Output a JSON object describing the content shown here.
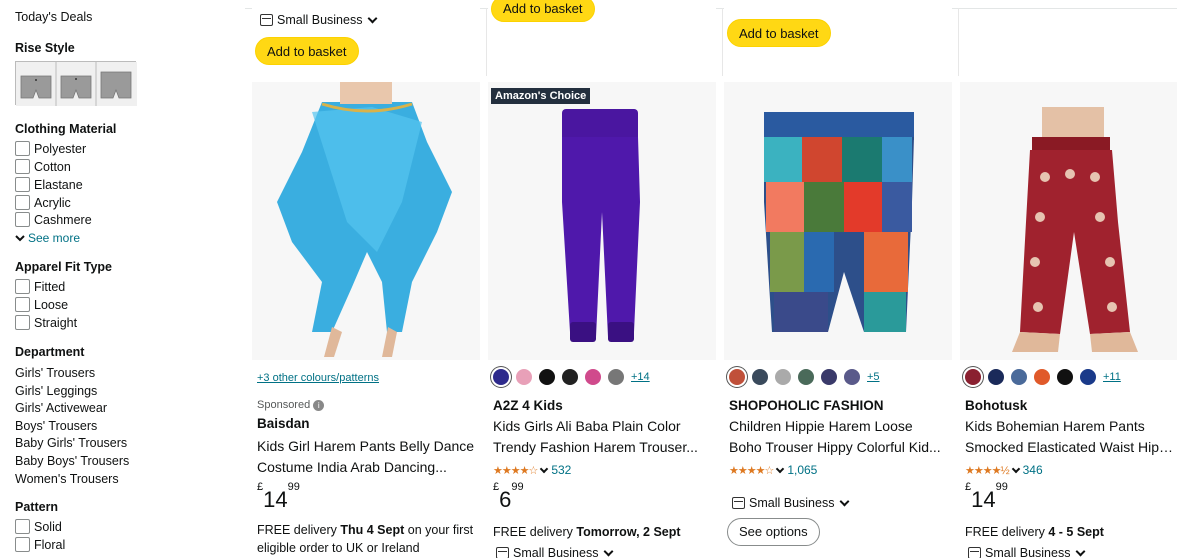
{
  "sidebar": {
    "todays_deals": "Today's Deals",
    "rise_style_heading": "Rise Style",
    "clothing_material_heading": "Clothing Material",
    "materials": [
      "Polyester",
      "Cotton",
      "Elastane",
      "Acrylic",
      "Cashmere"
    ],
    "see_more": "See more",
    "fit_heading": "Apparel Fit Type",
    "fits": [
      "Fitted",
      "Loose",
      "Straight"
    ],
    "department_heading": "Department",
    "departments": [
      "Girls' Trousers",
      "Girls' Leggings",
      "Girls' Activewear",
      "Boys' Trousers",
      "Baby Girls' Trousers",
      "Baby Boys' Trousers",
      "Women's Trousers"
    ],
    "pattern_heading": "Pattern",
    "patterns": [
      "Solid",
      "Floral"
    ]
  },
  "top_row": {
    "small_business": "Small Business",
    "add_to_basket": "Add to basket"
  },
  "products": [
    {
      "colours_link": "+3 other colours/patterns",
      "sponsored": "Sponsored",
      "brand": "Baisdan",
      "title_lines": [
        "Kids Girl Harem Pants Belly Dance",
        "Costume India Arab Dancing..."
      ],
      "price_whole": "14",
      "price_fraction": "99",
      "currency": "£",
      "delivery_prefix": "FREE delivery ",
      "delivery_date": "Thu 4 Sept",
      "delivery_suffix": " on your first eligible order to UK or Ireland"
    },
    {
      "badge": "Amazon's Choice",
      "swatch_colors": [
        "#2e2a8c",
        "#e8a0b8",
        "#111111",
        "#222222",
        "#d04a8c",
        "#777777"
      ],
      "more_swatches": "+14",
      "brand": "A2Z 4 Kids",
      "title_lines": [
        "Kids Girls Ali Baba Plain Color",
        "Trendy Fashion Harem Trouser..."
      ],
      "stars": "★★★★☆",
      "rating_count": "532",
      "price_whole": "6",
      "price_fraction": "99",
      "currency": "£",
      "delivery_prefix": "FREE delivery ",
      "delivery_date": "Tomorrow, 2 Sept",
      "small_business": "Small Business"
    },
    {
      "swatch_colors": [
        "#c0503a",
        "#3a4a5c",
        "#aaaaaa",
        "#4a6a5a",
        "#3a3a6a",
        "#5a5a8a"
      ],
      "more_swatches": "+5",
      "brand": "SHOPOHOLIC FASHION",
      "title_lines": [
        "Children Hippie Harem Loose",
        "Boho Trouser Hippy Colorful Kid..."
      ],
      "stars": "★★★★☆",
      "rating_count": "1,065",
      "small_business": "Small Business",
      "see_options": "See options"
    },
    {
      "swatch_colors": [
        "#8a2030",
        "#1a2a5a",
        "#4a6a9a",
        "#e05a2a",
        "#111111",
        "#1a3a8a"
      ],
      "more_swatches": "+11",
      "brand": "Bohotusk",
      "title_lines": [
        "Kids Bohemian Harem Pants",
        "Smocked Elasticated Waist Hipp..."
      ],
      "stars": "★★★★½",
      "rating_count": "346",
      "price_whole": "14",
      "price_fraction": "99",
      "currency": "£",
      "delivery_prefix": "FREE delivery ",
      "delivery_date": "4 - 5 Sept",
      "small_business": "Small Business"
    }
  ]
}
